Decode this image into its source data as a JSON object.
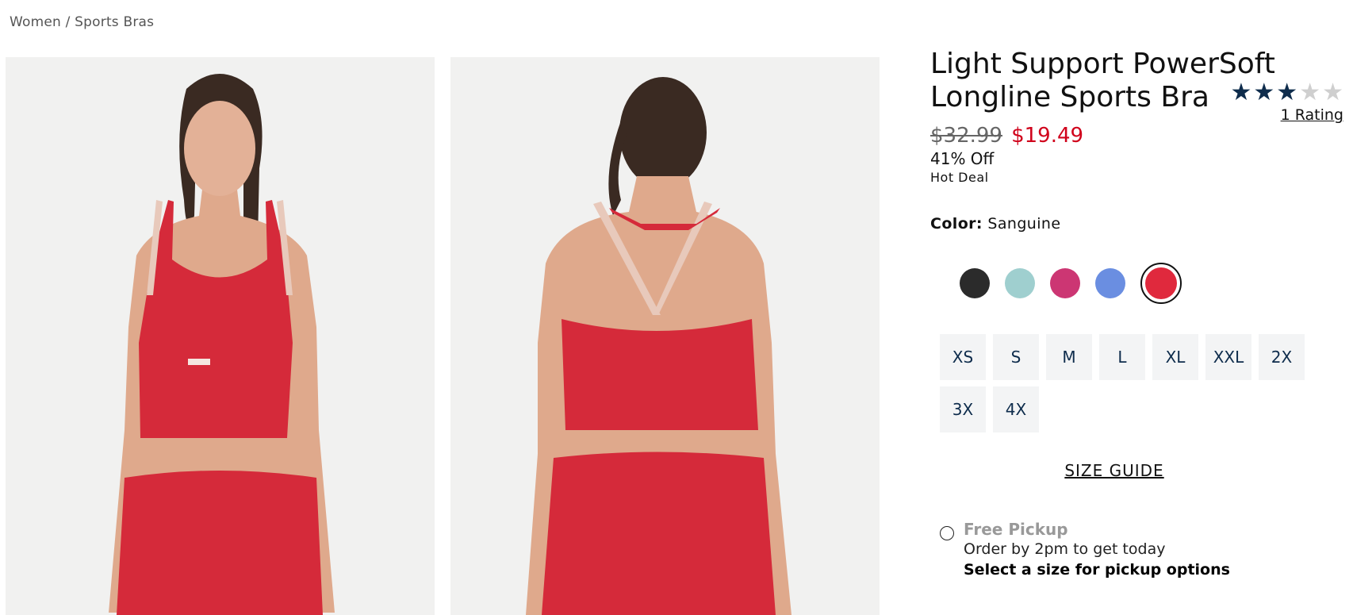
{
  "breadcrumb": {
    "items": [
      "Women",
      "Sports Bras"
    ],
    "separator": "/"
  },
  "gallery": {
    "images": [
      {
        "view": "front",
        "model": "woman with dark ponytail in red longline sports bra and red leggings"
      },
      {
        "view": "back",
        "model": "same model shown from behind, strappy racerback"
      }
    ]
  },
  "product": {
    "title": "Light Support PowerSoft Longline Sports Bra",
    "price_original": "$32.99",
    "price_sale": "$19.49",
    "discount": "41% Off",
    "deal_label": "Hot Deal",
    "rating": {
      "stars_filled": 3,
      "stars_total": 5,
      "label": "1 Rating"
    },
    "color": {
      "label": "Color:",
      "value": "Sanguine"
    },
    "swatches": [
      {
        "name": "black",
        "hex": "#2b2b2b",
        "selected": false
      },
      {
        "name": "aqua",
        "hex": "#9fcfcf",
        "selected": false
      },
      {
        "name": "pink",
        "hex": "#cc3673",
        "selected": false
      },
      {
        "name": "blue",
        "hex": "#6a8ee1",
        "selected": false
      },
      {
        "name": "sanguine",
        "hex": "#e0293d",
        "selected": true
      }
    ],
    "sizes": [
      "XS",
      "S",
      "M",
      "L",
      "XL",
      "XXL",
      "2X",
      "3X",
      "4X"
    ],
    "size_guide": "SIZE GUIDE",
    "pickup": {
      "title": "Free Pickup",
      "subtitle": "Order by 2pm to get today",
      "note": "Select a size for pickup options"
    }
  },
  "colors": {
    "price_sale": "#d0021b",
    "star_filled": "#0e2c4c",
    "size_text": "#0e2c4c",
    "size_bg": "#f3f4f5"
  }
}
